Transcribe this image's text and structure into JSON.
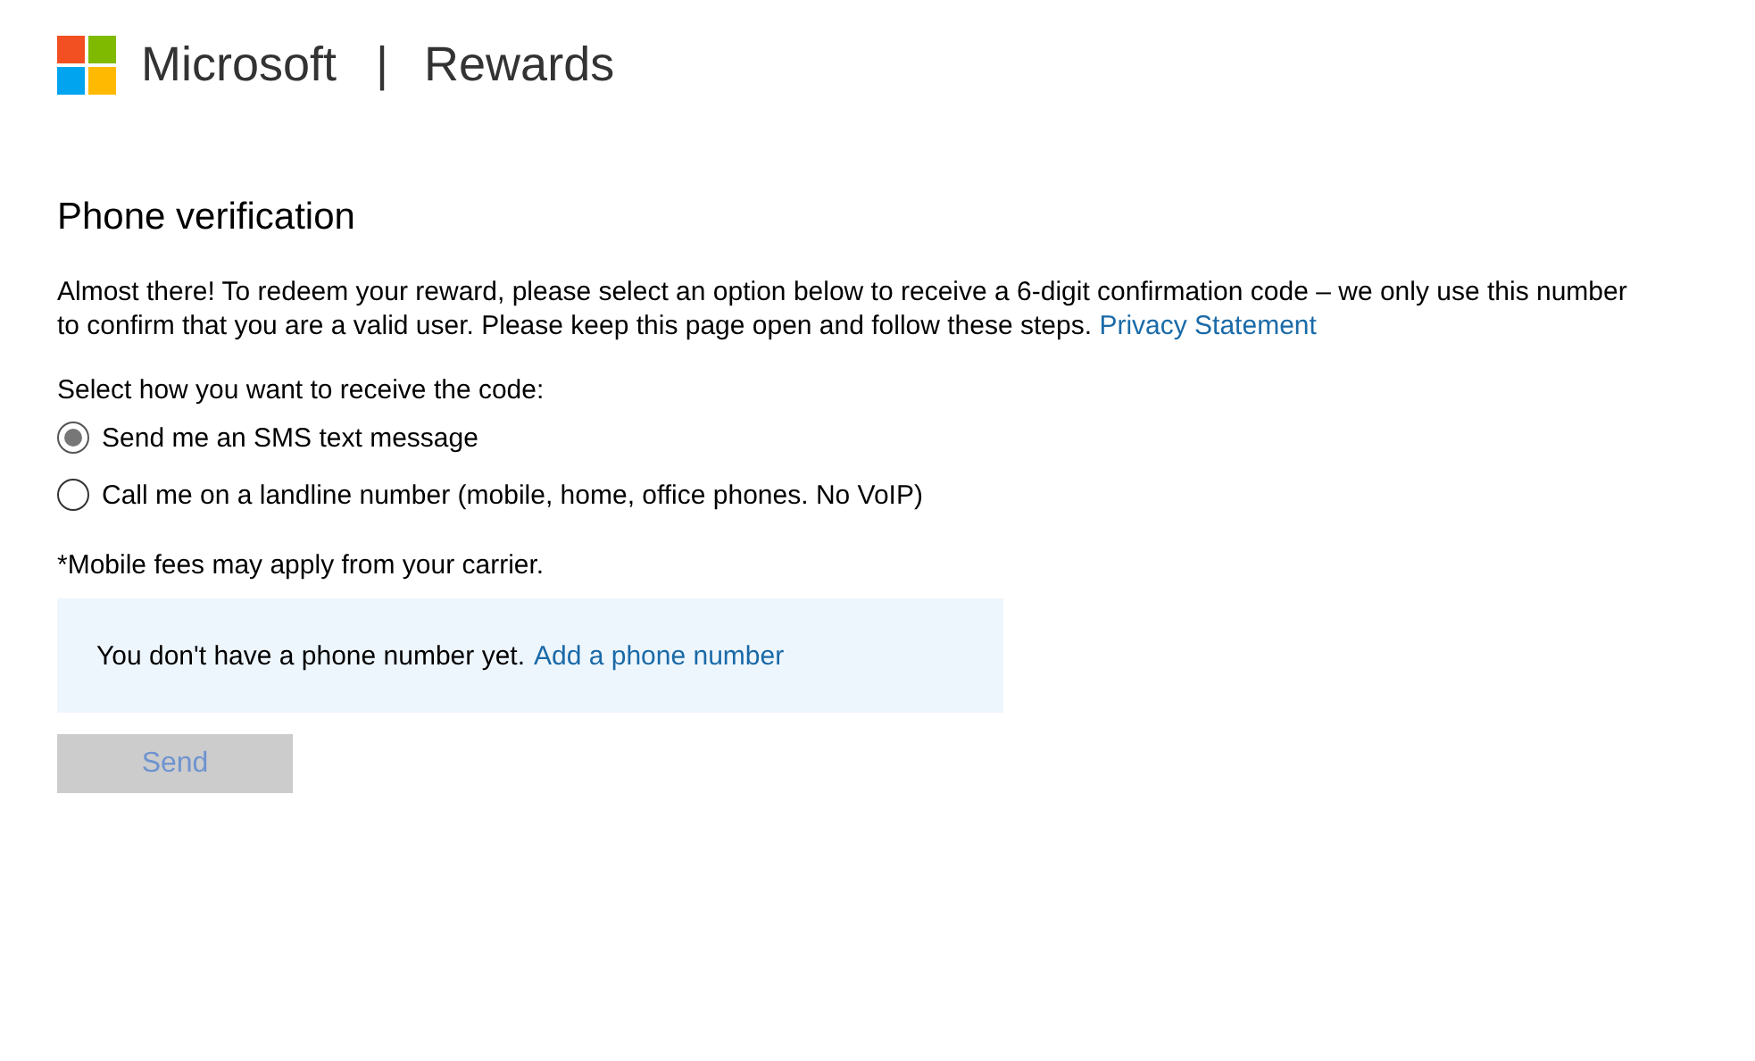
{
  "header": {
    "brand": "Microsoft",
    "separator": "|",
    "product": "Rewards"
  },
  "title": "Phone verification",
  "intro": {
    "text": "Almost there! To redeem your reward, please select an option below to receive a 6-digit confirmation code – we only use this number to confirm that you are a valid user. Please keep this page open and follow these steps.",
    "link": "Privacy Statement"
  },
  "prompt": "Select how you want to receive the code:",
  "options": [
    {
      "label": "Send me an SMS text message",
      "selected": true
    },
    {
      "label": "Call me on a landline number (mobile, home, office phones. No VoIP)",
      "selected": false
    }
  ],
  "note": "*Mobile fees may apply from your carrier.",
  "info": {
    "text": "You don't have a phone number yet.",
    "link": "Add a phone number"
  },
  "send_button": {
    "label": "Send",
    "disabled": true
  }
}
